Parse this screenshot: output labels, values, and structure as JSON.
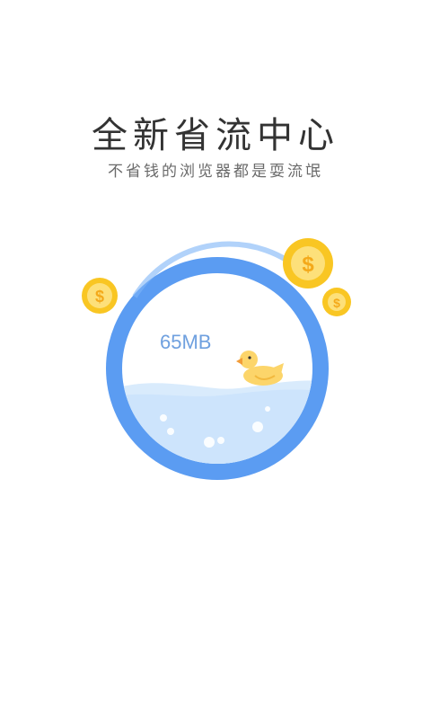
{
  "splash": {
    "title": "全新省流中心",
    "subtitle": "不省钱的浏览器都是耍流氓"
  },
  "traffic": {
    "value": "65MB"
  },
  "icons": {
    "coins": [
      "dollar-coin-icon",
      "dollar-coin-icon",
      "dollar-coin-icon"
    ],
    "mascot": "duck-icon"
  },
  "colors": {
    "ring": "#5b9cf2",
    "water": "#d8ebfc",
    "coin": "#f9c623",
    "duck": "#fcd56a",
    "text_dark": "#333333",
    "text_light": "#6a6a6a"
  }
}
